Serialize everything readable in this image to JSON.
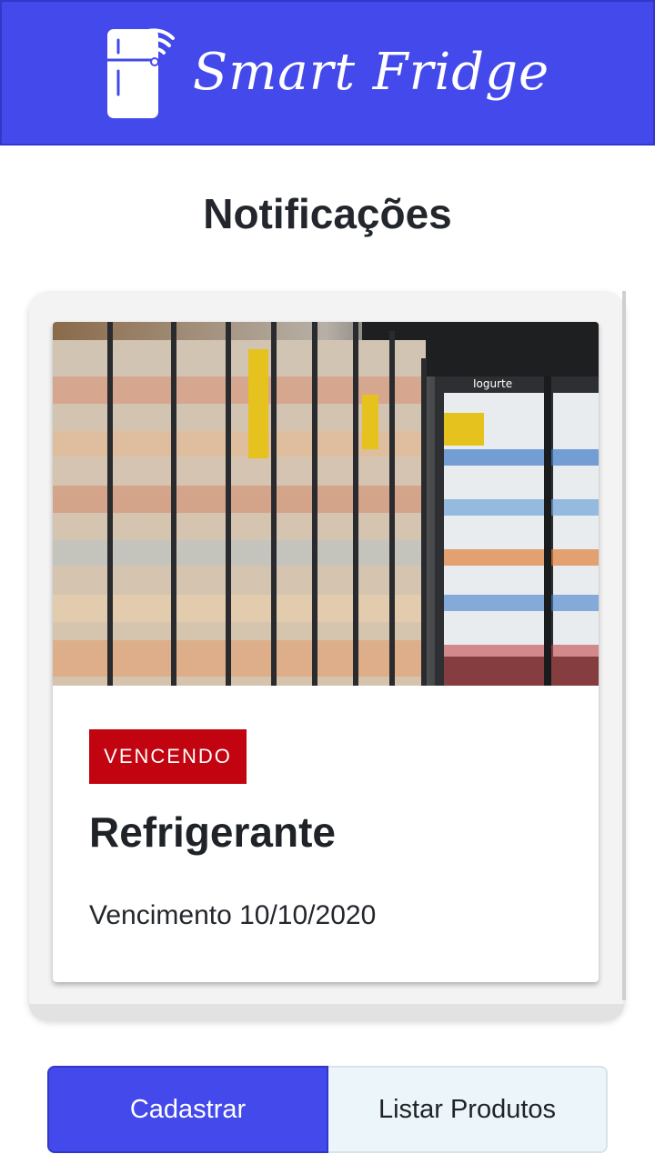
{
  "app": {
    "title": "Smart Fridge",
    "logo_icon": "smart-fridge-wifi-icon"
  },
  "page": {
    "title": "Notificações"
  },
  "notifications": [
    {
      "image": "supermarket-fridge-aisle-photo",
      "status": "VENCENDO",
      "product": "Refrigerante",
      "expiry_text": "Vencimento 10/10/2020"
    }
  ],
  "actions": {
    "register_label": "Cadastrar",
    "list_label": "Listar Produtos"
  },
  "colors": {
    "primary": "#4349ea",
    "badge_red": "#c20310",
    "secondary_bg": "#ecf5f9"
  }
}
